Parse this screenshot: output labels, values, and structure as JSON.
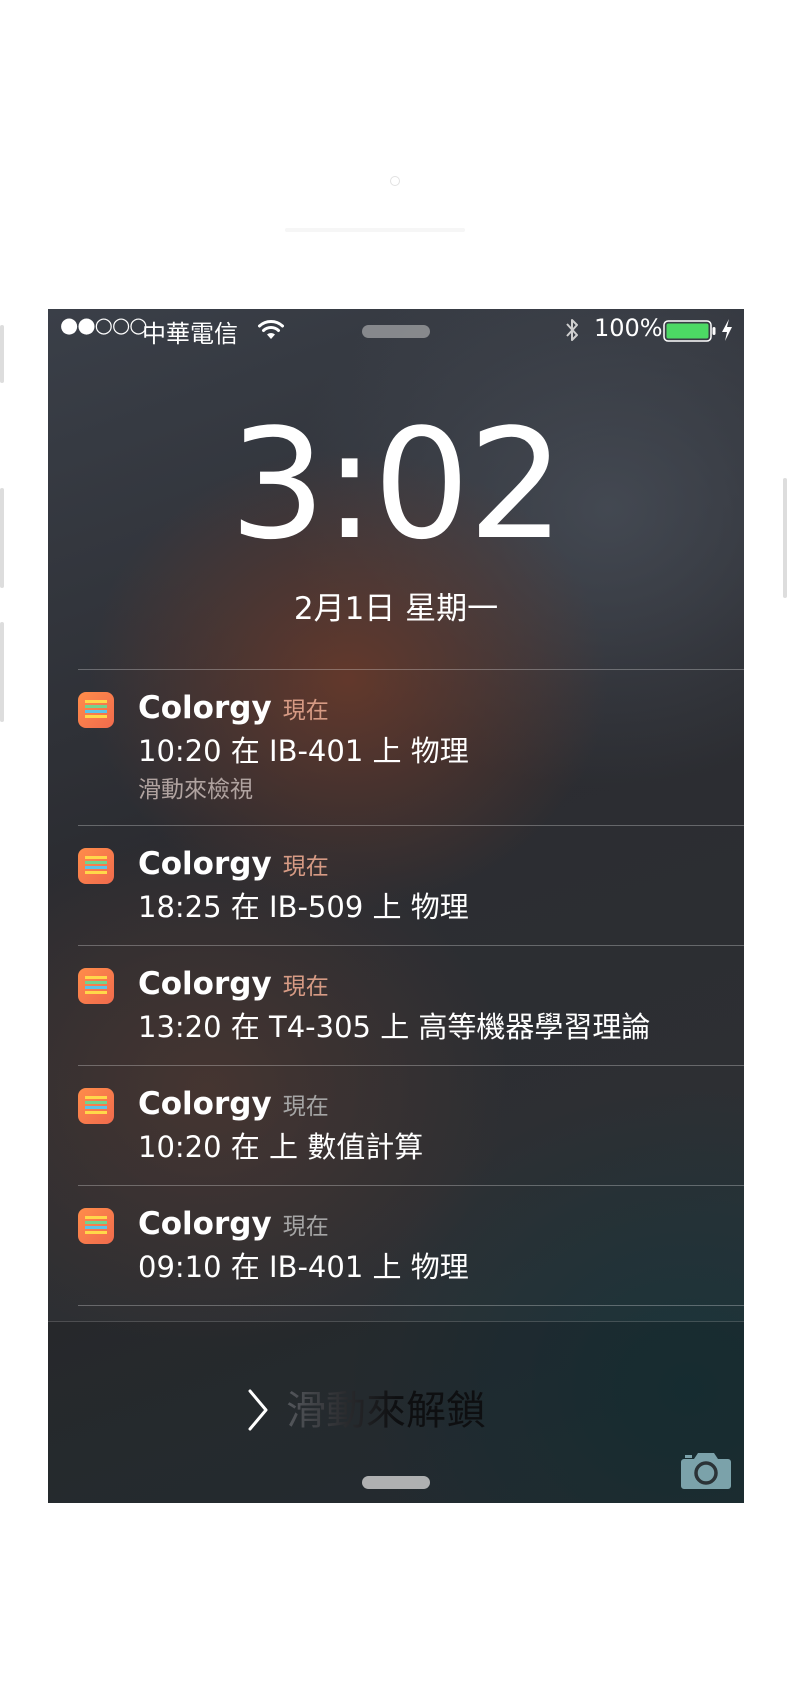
{
  "status_bar": {
    "signal": "●●○○○",
    "carrier": "中華電信",
    "battery_percent": "100%",
    "icons": [
      "wifi-icon",
      "bluetooth-icon",
      "battery-icon",
      "charging-bolt-icon"
    ]
  },
  "lock_screen": {
    "time_hours": "3",
    "time_sep": ":",
    "time_minutes": "02",
    "date": "2月1日 星期一"
  },
  "notifications": [
    {
      "app": "Colorgy",
      "time": "現在",
      "body": "10:20 在 IB-401 上 物理",
      "hint": "滑動來檢視"
    },
    {
      "app": "Colorgy",
      "time": "現在",
      "body": "18:25 在 IB-509 上 物理"
    },
    {
      "app": "Colorgy",
      "time": "現在",
      "body": "13:20 在 T4-305 上 高等機器學習理論"
    },
    {
      "app": "Colorgy",
      "time": "現在",
      "body": "10:20 在  上 數值計算"
    },
    {
      "app": "Colorgy",
      "time": "現在",
      "body": "09:10 在 IB-401 上 物理"
    }
  ],
  "unlock": {
    "label": "滑動來解鎖",
    "icons": [
      "chevron-right-icon",
      "camera-icon"
    ]
  },
  "colors": {
    "battery_fill": "#4cd964",
    "time_label_tint": "#d69a84"
  }
}
